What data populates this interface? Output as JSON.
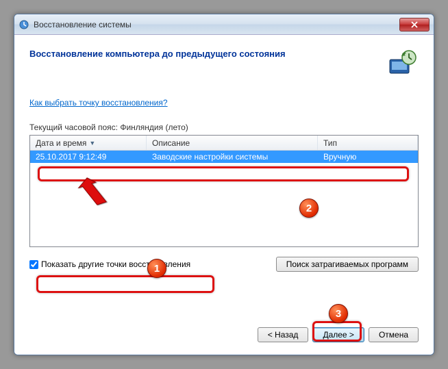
{
  "window": {
    "title": "Восстановление системы"
  },
  "header": {
    "heading": "Восстановление компьютера до предыдущего состояния"
  },
  "link": {
    "how_to_choose": "Как выбрать точку восстановления?"
  },
  "timezone": {
    "label": "Текущий часовой пояс: Финляндия (лето)"
  },
  "table": {
    "columns": {
      "datetime": "Дата и время",
      "description": "Описание",
      "type": "Тип"
    },
    "rows": [
      {
        "datetime": "25.10.2017 9:12:49",
        "description": "Заводские настройки системы",
        "type": "Вручную"
      }
    ]
  },
  "checkbox": {
    "label": "Показать другие точки восстановления",
    "checked": true
  },
  "buttons": {
    "affected": "Поиск затрагиваемых программ",
    "back": "< Назад",
    "next": "Далее >",
    "cancel": "Отмена"
  },
  "annotations": {
    "badge1": "1",
    "badge2": "2",
    "badge3": "3"
  }
}
